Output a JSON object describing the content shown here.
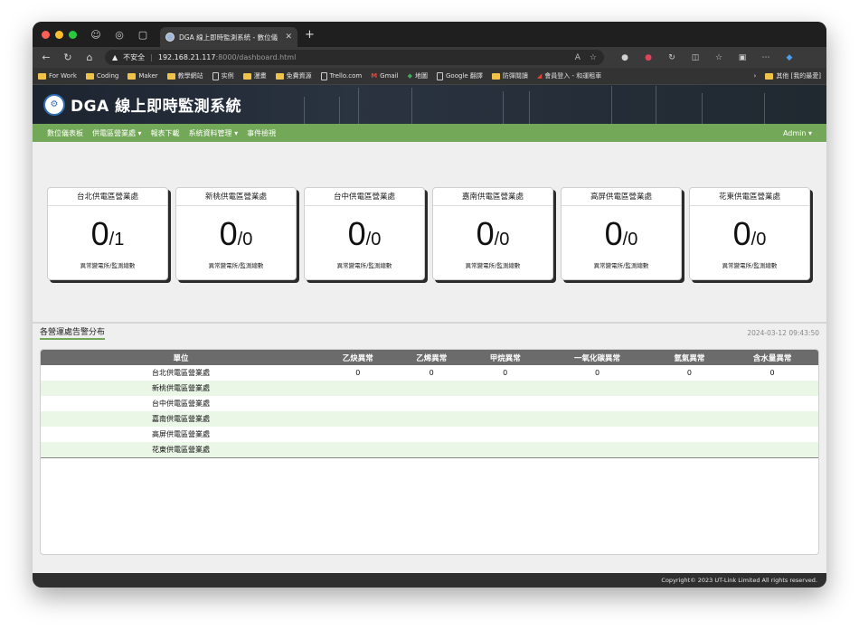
{
  "browser": {
    "tab_title": "DGA 線上即時監測系統 - 數位儀",
    "url_warning": "不安全",
    "url_host": "192.168.21.117",
    "url_path": ":8000/dashboard.html",
    "bookmarks": [
      {
        "label": "For Work",
        "type": "folder"
      },
      {
        "label": "Coding",
        "type": "folder"
      },
      {
        "label": "Maker",
        "type": "folder"
      },
      {
        "label": "教學網站",
        "type": "folder"
      },
      {
        "label": "实例",
        "type": "page"
      },
      {
        "label": "漫畫",
        "type": "folder"
      },
      {
        "label": "免費資源",
        "type": "folder"
      },
      {
        "label": "Trello.com",
        "type": "page"
      },
      {
        "label": "Gmail",
        "type": "gmail"
      },
      {
        "label": "地圖",
        "type": "maps"
      },
      {
        "label": "Google 翻譯",
        "type": "page"
      },
      {
        "label": "防彈閱讀",
        "type": "folder"
      },
      {
        "label": "會員登入 - 和運租車",
        "type": "site"
      }
    ],
    "bookmarks_other": "其他 [我的最愛]"
  },
  "header": {
    "system_title": "DGA 線上即時監測系統"
  },
  "nav": {
    "items": [
      "數位儀表板",
      "供電區營業處 ▾",
      "報表下載",
      "系統資料管理 ▾",
      "事件檢視"
    ],
    "user": "Admin ▾"
  },
  "cards": [
    {
      "name": "台北供電區營業處",
      "abnormal": "0",
      "total": "1",
      "desc": "異常變電所/監測總數"
    },
    {
      "name": "新桃供電區營業處",
      "abnormal": "0",
      "total": "0",
      "desc": "異常變電所/監測總數"
    },
    {
      "name": "台中供電區營業處",
      "abnormal": "0",
      "total": "0",
      "desc": "異常變電所/監測總數"
    },
    {
      "name": "嘉南供電區營業處",
      "abnormal": "0",
      "total": "0",
      "desc": "異常變電所/監測總數"
    },
    {
      "name": "高屏供電區營業處",
      "abnormal": "0",
      "total": "0",
      "desc": "異常變電所/監測總數"
    },
    {
      "name": "花東供電區營業處",
      "abnormal": "0",
      "total": "0",
      "desc": "異常變電所/監測總數"
    }
  ],
  "alarm_section": {
    "title": "各營運處告警分布",
    "timestamp": "2024-03-12 09:43:50",
    "columns": [
      "單位",
      "乙炔異常",
      "乙烯異常",
      "甲烷異常",
      "一氧化碳異常",
      "氫氣異常",
      "含水量異常"
    ],
    "rows": [
      [
        "台北供電區營業處",
        "0",
        "0",
        "0",
        "0",
        "0",
        "0"
      ],
      [
        "新桃供電區營業處",
        "",
        "",
        "",
        "",
        "",
        ""
      ],
      [
        "台中供電區營業處",
        "",
        "",
        "",
        "",
        "",
        ""
      ],
      [
        "嘉南供電區營業處",
        "",
        "",
        "",
        "",
        "",
        ""
      ],
      [
        "高屏供電區營業處",
        "",
        "",
        "",
        "",
        "",
        ""
      ],
      [
        "花東供電區營業處",
        "",
        "",
        "",
        "",
        "",
        ""
      ]
    ]
  },
  "footer": {
    "copyright": "Copyright© 2023 UT-Link Limited All rights reserved."
  },
  "colors": {
    "nav_green": "#73a858",
    "table_header": "#6b6b6b",
    "row_stripe": "#eaf6e6"
  }
}
